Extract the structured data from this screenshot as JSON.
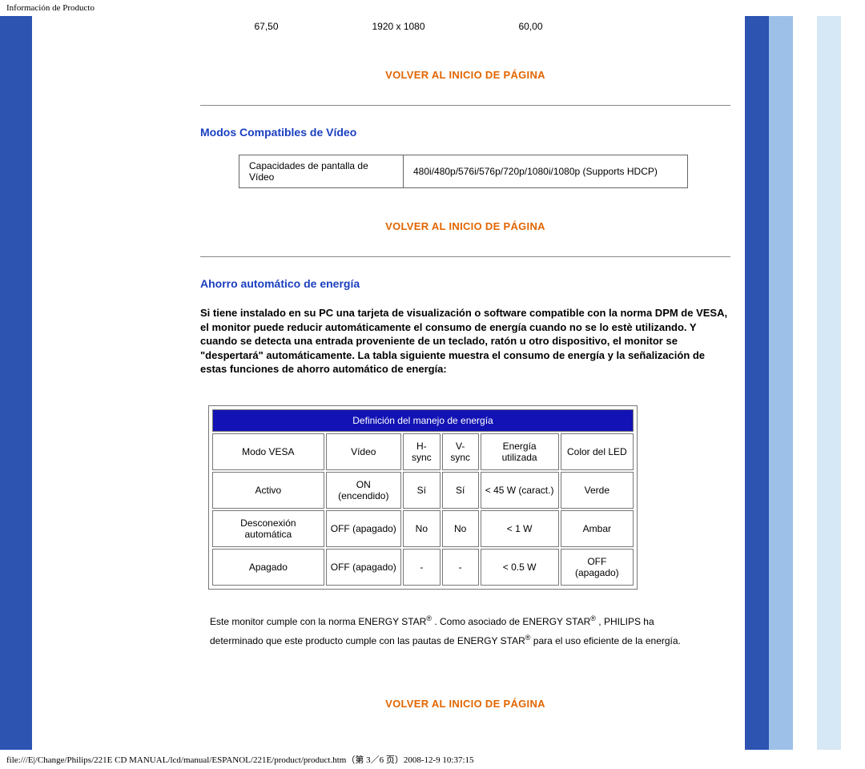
{
  "page_header": "Información de Producto",
  "small_row": {
    "c1": "67,50",
    "c2": "1920 x 1080",
    "c3": "60,00"
  },
  "back_to_top": "VOLVER AL INICIO DE PÁGINA",
  "section1_title": "Modos Compatibles de Vídeo",
  "video_table": {
    "label": "Capacidades de pantalla de Vídeo",
    "value": "480i/480p/576i/576p/720p/1080i/1080p (Supports HDCP)"
  },
  "section2_title": "Ahorro automático de energía",
  "energy_intro": "Si tiene instalado en su PC una tarjeta de visualización o software compatible con la norma DPM de VESA, el monitor puede reducir automáticamente el consumo de energía cuando no se lo estè utilizando. Y cuando se detecta una entrada proveniente de un teclado, ratón u otro dispositivo, el monitor se \"despertará\" automáticamente. La tabla siguiente muestra el consumo de energía y la señalización de estas funciones de ahorro automático de energía:",
  "energy_table": {
    "header": "Definición del manejo de energía",
    "cols": [
      "Modo VESA",
      "Vídeo",
      "H-sync",
      "V-sync",
      "Energía utilizada",
      "Color del LED"
    ],
    "rows": [
      [
        "Activo",
        "ON (encendido)",
        "Sí",
        "Sí",
        "< 45 W (caract.)",
        "Verde"
      ],
      [
        "Desconexión automática",
        "OFF (apagado)",
        "No",
        "No",
        "< 1 W",
        "Ambar"
      ],
      [
        "Apagado",
        "OFF (apagado)",
        "-",
        "-",
        "< 0.5 W",
        "OFF (apagado)"
      ]
    ]
  },
  "compliance_1a": "Este monitor cumple con la norma ENERGY STAR",
  "compliance_1b": ". Como asociado de ENERGY STAR",
  "compliance_1c": ", PHILIPS ha",
  "compliance_2a": "determinado que este producto cumple con las pautas de ENERGY STAR",
  "compliance_2b": "para el uso eficiente de la energía.",
  "page_footer": "file:///E|/Change/Philips/221E CD MANUAL/lcd/manual/ESPANOL/221E/product/product.htm（第 3／6 页）2008-12-9 10:37:15"
}
